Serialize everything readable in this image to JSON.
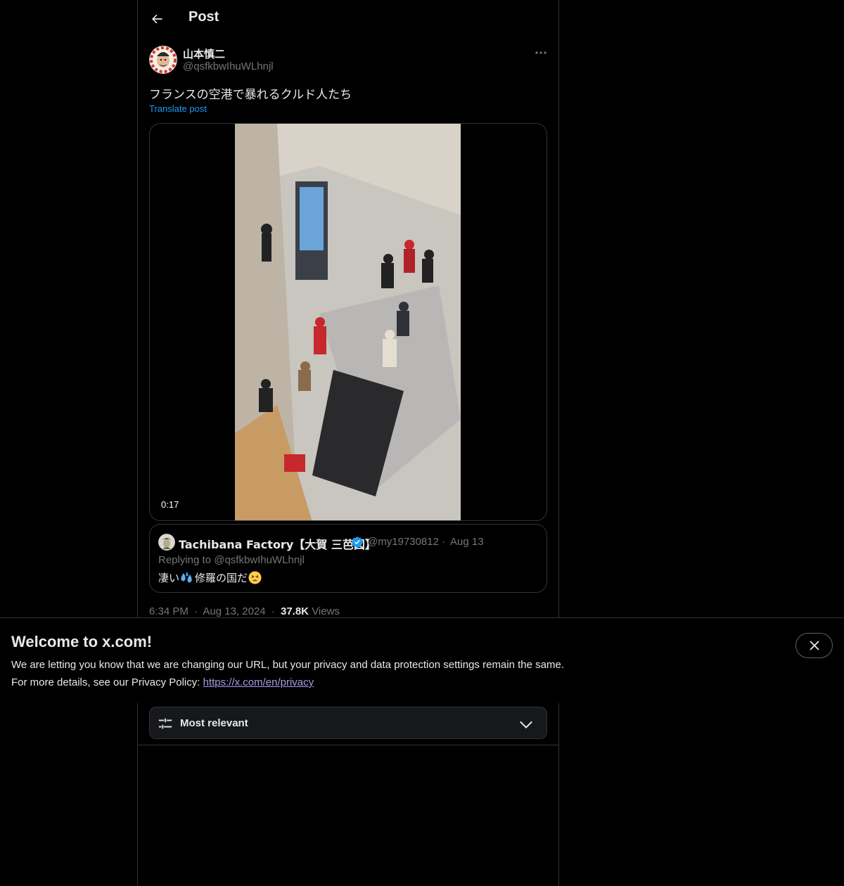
{
  "header": {
    "title": "Post"
  },
  "post": {
    "author_name": "山本慎二",
    "author_handle": "@qsfkbwIhuWLhnjl",
    "text": "フランスの空港で暴れるクルド人たち",
    "translate_label": "Translate post",
    "video_duration": "0:17",
    "time": "6:34 PM",
    "separator": "·",
    "date": "Aug 13, 2024",
    "views_count": "37.8K",
    "views_label": "Views"
  },
  "quote": {
    "name": "Tachibana Factory【大賀 三芭図】",
    "handle": "@my19730812",
    "separator": "·",
    "date": "Aug 13",
    "replying_to": "Replying to @qsfkbwIhuWLhnjl",
    "text_part1": "凄い",
    "text_part2": "修羅の国だ"
  },
  "sort": {
    "label": "Most relevant"
  },
  "banner": {
    "title": "Welcome to x.com!",
    "line1": "We are letting you know that we are changing our URL, but your privacy and data protection settings remain the same.",
    "line2_prefix": "For more details, see our Privacy Policy: ",
    "link": "https://x.com/en/privacy"
  },
  "colors": {
    "accent": "#1d9bf0",
    "link": "#a99be7",
    "muted": "#71767b",
    "border": "#2f3336"
  },
  "icons": [
    "back-arrow-icon",
    "more-icon",
    "verified-icon",
    "sweat-emoji-icon",
    "weary-emoji-icon",
    "sliders-icon",
    "chevron-down-icon",
    "close-icon"
  ]
}
